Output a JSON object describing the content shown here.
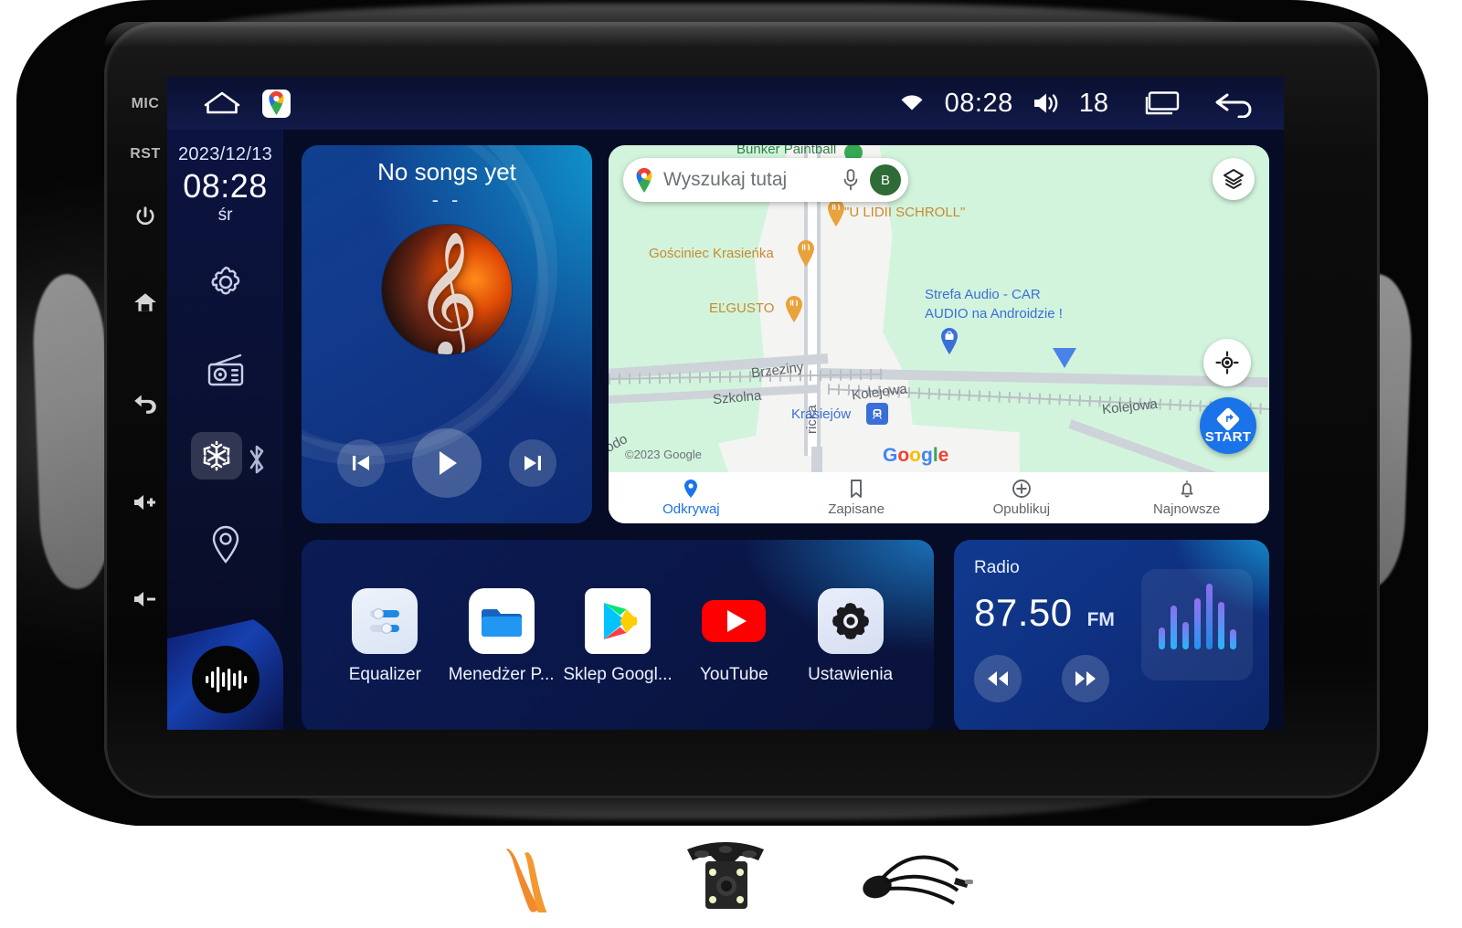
{
  "device": {
    "hardware_buttons": [
      {
        "name": "mic",
        "label": "MIC"
      },
      {
        "name": "reset",
        "label": "RST"
      },
      {
        "name": "power",
        "label": "power-icon"
      },
      {
        "name": "home",
        "label": "home-icon"
      },
      {
        "name": "back",
        "label": "back-icon"
      },
      {
        "name": "volume-up",
        "label": "volume-up-icon"
      },
      {
        "name": "volume-down",
        "label": "volume-down-icon"
      }
    ]
  },
  "statusbar": {
    "home_icon": "home-outline-icon",
    "app_icon": "google-maps-icon",
    "wifi_icon": "wifi-icon",
    "clock": "08:28",
    "volume_icon": "volume-icon",
    "volume_value": "18",
    "recents_icon": "recents-icon",
    "back_icon": "back-arrow-icon"
  },
  "rail": {
    "date": "2023/12/13",
    "time": "08:28",
    "weekday": "śr",
    "icons": [
      "settings-icon",
      "radio-icon",
      "snowflake-icon",
      "bluetooth-icon",
      "location-icon"
    ],
    "bottom_icon": "audio-waveform-icon"
  },
  "music": {
    "title": "No songs yet",
    "subtitle": "- -",
    "album_art": "fire-and-ice-treble-clef",
    "prev_label": "⏮",
    "play_label": "▶",
    "next_label": "⏭"
  },
  "map": {
    "search_placeholder": "Wyszukaj tutaj",
    "mic_icon": "microphone-icon",
    "avatar_initial": "B",
    "layers_icon": "layers-icon",
    "locate_icon": "my-location-icon",
    "start_label": "START",
    "start_icon": "navigation-arrow-icon",
    "copyright": "©2023 Google",
    "watermark": [
      "G",
      "o",
      "o",
      "g",
      "l",
      "e"
    ],
    "pois": [
      {
        "name": "Bunker Paintball",
        "type": "park"
      },
      {
        "name": "\"U LIDII SCHROLL\"",
        "type": "restaurant"
      },
      {
        "name": "Gościniec Krasieńka",
        "type": "restaurant"
      },
      {
        "name": "EĽGUSTO",
        "type": "restaurant"
      },
      {
        "name": "Strefa Audio - CAR",
        "type": "business"
      },
      {
        "name": "AUDIO na Androidzie !",
        "type": "business"
      },
      {
        "name": "Krasiejów",
        "type": "transit"
      }
    ],
    "streets": [
      "Brzeziny",
      "Kolejowa",
      "Kolejowa",
      "Szkolna",
      "Kolejowa",
      "ricka",
      "odo"
    ],
    "nav_items": [
      {
        "label": "Odkrywaj",
        "icon": "explore-pin-icon",
        "active": true
      },
      {
        "label": "Zapisane",
        "icon": "bookmark-icon",
        "active": false
      },
      {
        "label": "Opublikuj",
        "icon": "plus-circle-icon",
        "active": false
      },
      {
        "label": "Najnowsze",
        "icon": "bell-icon",
        "active": false
      }
    ]
  },
  "apps": [
    {
      "label": "Equalizer",
      "icon": "equalizer-icon"
    },
    {
      "label": "Menedżer P...",
      "icon": "file-manager-icon"
    },
    {
      "label": "Sklep Googl...",
      "icon": "google-play-icon"
    },
    {
      "label": "YouTube",
      "icon": "youtube-icon"
    },
    {
      "label": "Ustawienia",
      "icon": "settings-gear-icon"
    }
  ],
  "radio": {
    "title": "Radio",
    "frequency": "87.50",
    "band": "FM",
    "prev_icon": "rewind-icon",
    "next_icon": "fast-forward-icon",
    "art_icon": "audio-waveform-icon"
  },
  "accessories": [
    {
      "name": "pry-tools",
      "label": "pry-tools"
    },
    {
      "name": "rear-camera",
      "label": "rear-camera"
    },
    {
      "name": "external-microphone",
      "label": "external-microphone"
    }
  ],
  "colors": {
    "accent_blue": "#1a73e8",
    "panel_navy": "#0b1b55",
    "map_green": "#d2f4dd",
    "poi_orange": "#e8a33d"
  }
}
